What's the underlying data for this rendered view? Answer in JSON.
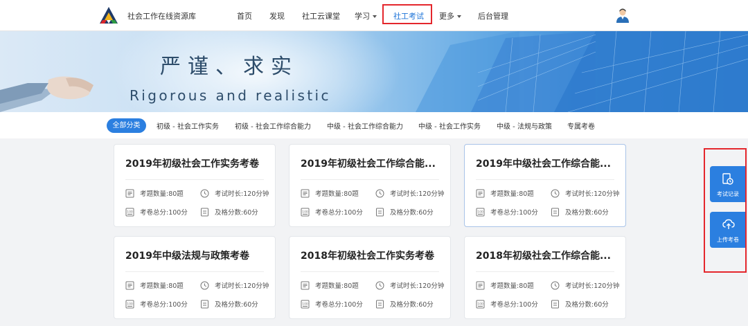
{
  "header": {
    "site_name": "社会工作在线资源库",
    "nav": [
      {
        "label": "首页"
      },
      {
        "label": "发现"
      },
      {
        "label": "社工云课堂"
      },
      {
        "label": "学习"
      },
      {
        "label": "社工考试"
      },
      {
        "label": "更多"
      },
      {
        "label": "后台管理"
      }
    ],
    "active_nav": "社工考试"
  },
  "banner": {
    "title": "严谨、求实",
    "subtitle": "Rigorous and realistic"
  },
  "filters": {
    "items": [
      {
        "label": "全部分类"
      },
      {
        "label": "初级 - 社会工作实务"
      },
      {
        "label": "初级 - 社会工作综合能力"
      },
      {
        "label": "中级 - 社会工作综合能力"
      },
      {
        "label": "中级 - 社会工作实务"
      },
      {
        "label": "中级 - 法规与政策"
      },
      {
        "label": "专属考卷"
      }
    ],
    "active": "全部分类"
  },
  "cards": [
    {
      "title": "2019年初级社会工作实务考卷",
      "question_count": "考题数量:80题",
      "duration": "考试时长:120分钟",
      "total_score": "考卷总分:100分",
      "pass_score": "及格分数:60分"
    },
    {
      "title": "2019年初级社会工作综合能...",
      "question_count": "考题数量:80题",
      "duration": "考试时长:120分钟",
      "total_score": "考卷总分:100分",
      "pass_score": "及格分数:60分"
    },
    {
      "title": "2019年中级社会工作综合能...",
      "question_count": "考题数量:80题",
      "duration": "考试时长:120分钟",
      "total_score": "考卷总分:100分",
      "pass_score": "及格分数:60分"
    },
    {
      "title": "2019年中级法规与政策考卷",
      "question_count": "考题数量:80题",
      "duration": "考试时长:120分钟",
      "total_score": "考卷总分:100分",
      "pass_score": "及格分数:60分"
    },
    {
      "title": "2018年初级社会工作实务考卷",
      "question_count": "考题数量:80题",
      "duration": "考试时长:120分钟",
      "total_score": "考卷总分:100分",
      "pass_score": "及格分数:60分"
    },
    {
      "title": "2018年初级社会工作综合能...",
      "question_count": "考题数量:80题",
      "duration": "考试时长:120分钟",
      "total_score": "考卷总分:100分",
      "pass_score": "及格分数:60分"
    }
  ],
  "side_panel": {
    "exam_records_label": "考试记录",
    "upload_exam_label": "上传考卷"
  },
  "colors": {
    "accent": "#2b7fe0",
    "highlight_box": "#e4262c"
  },
  "icons": {
    "logo": "triangle-logo",
    "avatar": "user-avatar",
    "question_count": "document-list-icon",
    "duration": "clock-icon",
    "total_score": "score-100-icon",
    "pass_score": "checklist-icon",
    "exam_records": "records-clock-icon",
    "upload": "cloud-upload-icon"
  }
}
